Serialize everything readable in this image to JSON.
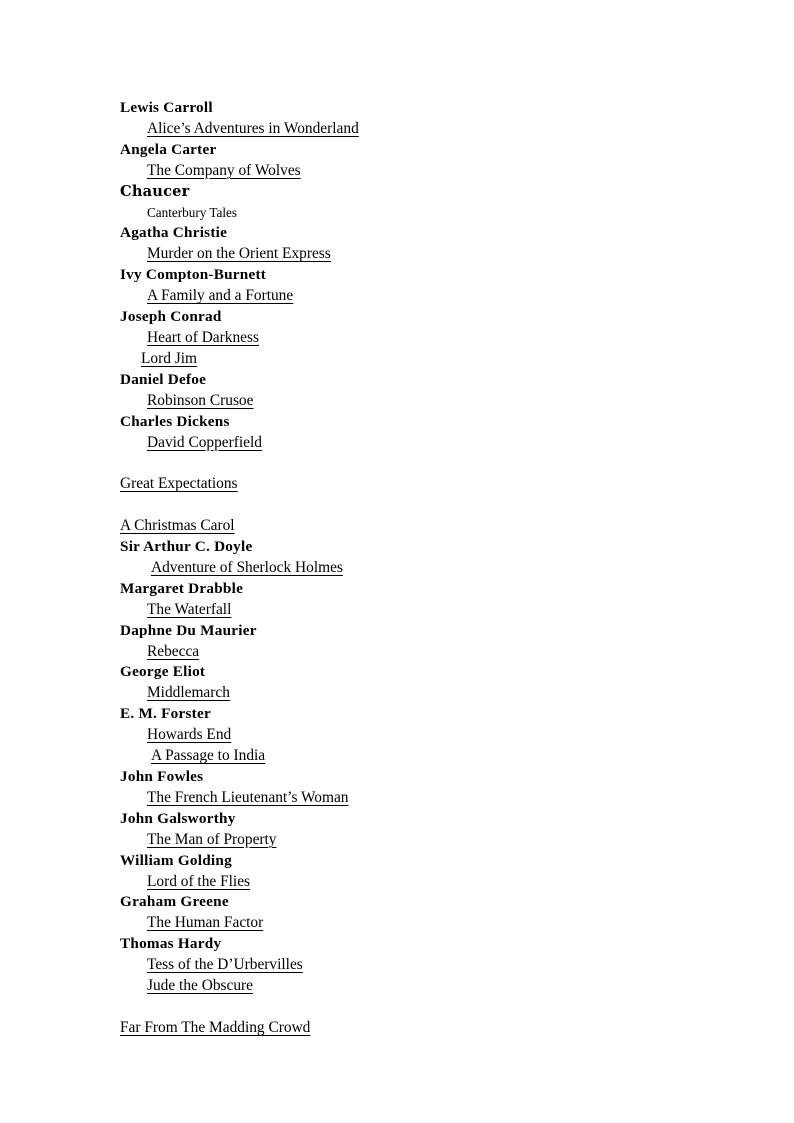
{
  "document": {
    "type": "reading-list",
    "page_background": "#ffffff",
    "text_color": "#000000"
  },
  "lines": [
    {
      "kind": "author",
      "text": "Lewis Carroll",
      "style": "serif-bold",
      "indent": "margin"
    },
    {
      "kind": "title",
      "text": "Alice’s Adventures in Wonderland",
      "underline": true,
      "indent": "normal"
    },
    {
      "kind": "author",
      "text": "Angela Carter",
      "style": "serif-bold",
      "indent": "margin"
    },
    {
      "kind": "title",
      "text": "The Company of Wolves",
      "underline": true,
      "indent": "normal"
    },
    {
      "kind": "author",
      "text": "Chaucer",
      "style": "slab-bold",
      "indent": "margin"
    },
    {
      "kind": "title",
      "text": "Canterbury Tales",
      "underline": false,
      "indent": "normal"
    },
    {
      "kind": "author",
      "text": "Agatha Christie",
      "style": "serif-bold",
      "indent": "margin"
    },
    {
      "kind": "title",
      "text": "Murder on the Orient Express",
      "underline": true,
      "indent": "normal"
    },
    {
      "kind": "author",
      "text": "Ivy Compton-Burnett",
      "style": "serif-bold",
      "indent": "margin"
    },
    {
      "kind": "title",
      "text": "A Family and a Fortune",
      "underline": true,
      "indent": "normal"
    },
    {
      "kind": "author",
      "text": "Joseph Conrad",
      "style": "serif-bold",
      "indent": "margin"
    },
    {
      "kind": "title",
      "text": "Heart of Darkness",
      "underline": true,
      "indent": "normal"
    },
    {
      "kind": "title",
      "text": "Lord Jim",
      "underline": true,
      "indent": "narrow"
    },
    {
      "kind": "author",
      "text": "Daniel Defoe",
      "style": "serif-bold",
      "indent": "margin"
    },
    {
      "kind": "title",
      "text": "Robinson Crusoe",
      "underline": true,
      "indent": "normal"
    },
    {
      "kind": "author",
      "text": "Charles Dickens",
      "style": "serif-bold",
      "indent": "margin"
    },
    {
      "kind": "title",
      "text": "David Copperfield",
      "underline": true,
      "indent": "normal"
    },
    {
      "kind": "blank",
      "text": ""
    },
    {
      "kind": "title",
      "text": "Great Expectations",
      "underline": true,
      "indent": "flush"
    },
    {
      "kind": "blank",
      "text": ""
    },
    {
      "kind": "title",
      "text": "A Christmas Carol",
      "underline": true,
      "indent": "flush"
    },
    {
      "kind": "author",
      "text": "Sir Arthur C. Doyle",
      "style": "serif-bold",
      "indent": "margin"
    },
    {
      "kind": "title",
      "text": "Adventure of Sherlock Holmes",
      "underline": true,
      "indent": "wide"
    },
    {
      "kind": "author",
      "text": "Margaret Drabble",
      "style": "serif-bold",
      "indent": "margin"
    },
    {
      "kind": "title",
      "text": "The Waterfall",
      "underline": true,
      "indent": "normal"
    },
    {
      "kind": "author",
      "text": "Daphne Du Maurier",
      "style": "serif-bold",
      "indent": "margin"
    },
    {
      "kind": "title",
      "text": "Rebecca",
      "underline": true,
      "indent": "normal"
    },
    {
      "kind": "author",
      "text": "George Eliot",
      "style": "serif-bold",
      "indent": "margin"
    },
    {
      "kind": "title",
      "text": "Middlemarch",
      "underline": true,
      "indent": "normal"
    },
    {
      "kind": "author",
      "text": "E. M. Forster",
      "style": "serif-bold",
      "indent": "margin"
    },
    {
      "kind": "title",
      "text": "Howards End",
      "underline": true,
      "indent": "normal"
    },
    {
      "kind": "title",
      "text": "A Passage to India",
      "underline": true,
      "indent": "wide"
    },
    {
      "kind": "author",
      "text": "John Fowles",
      "style": "serif-bold",
      "indent": "margin"
    },
    {
      "kind": "title",
      "text": "The French Lieutenant’s Woman",
      "underline": true,
      "indent": "normal"
    },
    {
      "kind": "author",
      "text": "John Galsworthy",
      "style": "serif-bold",
      "indent": "margin"
    },
    {
      "kind": "title",
      "text": "The Man of Property",
      "underline": true,
      "indent": "normal"
    },
    {
      "kind": "author",
      "text": "William Golding",
      "style": "serif-bold",
      "indent": "margin"
    },
    {
      "kind": "title",
      "text": "Lord of the Flies",
      "underline": true,
      "indent": "normal"
    },
    {
      "kind": "author",
      "text": "Graham Greene",
      "style": "serif-bold",
      "indent": "margin"
    },
    {
      "kind": "title",
      "text": "The Human Factor",
      "underline": true,
      "indent": "normal"
    },
    {
      "kind": "author",
      "text": "Thomas Hardy",
      "style": "serif-bold",
      "indent": "margin"
    },
    {
      "kind": "title",
      "text": "Tess of the D’Urbervilles",
      "underline": true,
      "indent": "normal"
    },
    {
      "kind": "title",
      "text": "Jude the Obscure",
      "underline": true,
      "indent": "normal"
    },
    {
      "kind": "blank",
      "text": ""
    },
    {
      "kind": "title",
      "text": "Far From The Madding Crowd",
      "underline": true,
      "indent": "flush"
    }
  ]
}
